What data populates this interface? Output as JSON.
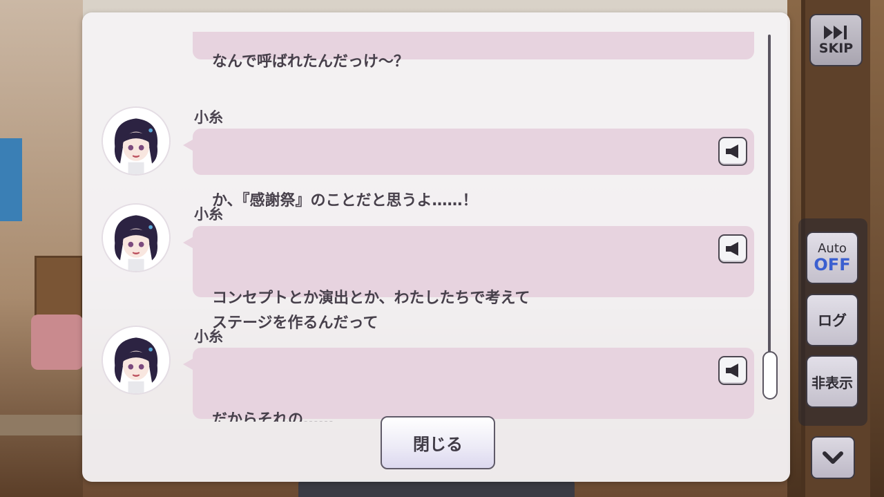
{
  "log": {
    "partial_top_text": "なんで呼ばれたんだっけ～？",
    "entries": [
      {
        "speaker": "小糸",
        "text": "か、『感謝祭』のことだと思うよ……！",
        "voice_icon": "speaker-icon"
      },
      {
        "speaker": "小糸",
        "text": "コンセプトとか演出とか、わたしたちで考えて\nステージを作るんだって",
        "voice_icon": "speaker-icon"
      },
      {
        "speaker": "小糸",
        "text": "だからそれの……\n相談、かな……？",
        "voice_icon": "speaker-icon"
      }
    ],
    "close_label": "閉じる"
  },
  "controls": {
    "skip_label": "SKIP",
    "skip_icon": "fast-forward-icon",
    "auto_label": "Auto",
    "auto_state": "OFF",
    "log_label": "ログ",
    "hide_label": "非表示",
    "down_icon": "chevron-down-icon"
  },
  "colors": {
    "bubble": "#e7d3df",
    "panel": "#f4f2f4",
    "auto_off": "#3a5fd0",
    "text": "#47404b"
  }
}
